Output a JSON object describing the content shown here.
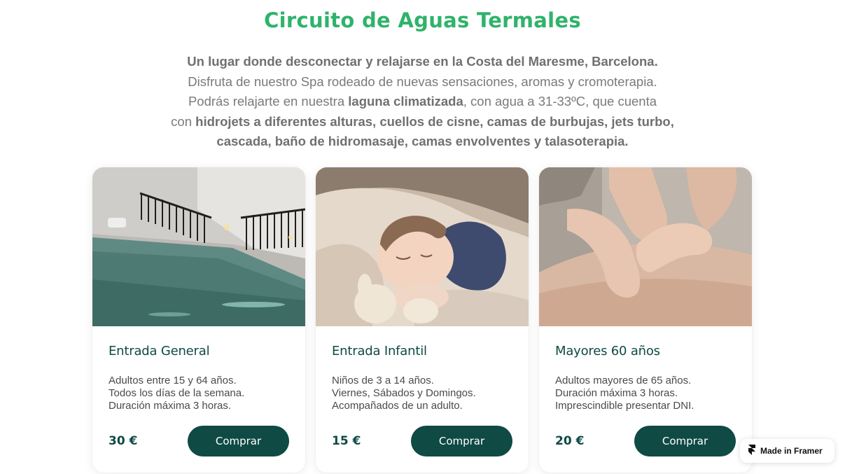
{
  "page": {
    "title": "Circuito de Aguas Termales",
    "intro": {
      "line1": "Un lugar donde desconectar y relajarse en la Costa del Maresme, Barcelona.",
      "line2": "Disfruta de nuestro Spa rodeado de nuevas sensaciones, aromas y cromoterapia.",
      "line3_a": "Podrás relajarte en nuestra ",
      "line3_b": "laguna climatizada",
      "line3_c": ", con agua a 31-33ºC, que cuenta",
      "line4_a": "con ",
      "line4_b": "hidrojets a diferentes alturas, cuellos de cisne, camas de burbujas, jets turbo,",
      "line5": "cascada, baño de hidromasaje, camas envolventes y talasoterapia."
    }
  },
  "cards": [
    {
      "title": "Entrada General",
      "desc": [
        "Adultos entre 15 y 64 años.",
        "Todos los días de la semana.",
        "Duración máxima 3 horas."
      ],
      "price": "30 €",
      "button": "Comprar"
    },
    {
      "title": "Entrada Infantil",
      "desc": [
        "Niños de 3 a 14 años.",
        "Viernes, Sábados y Domingos.",
        "Acompañados de un adulto."
      ],
      "price": "15 €",
      "button": "Comprar"
    },
    {
      "title": "Mayores 60 años",
      "desc": [
        "Adultos mayores de 65 años.",
        "Duración máxima 3 horas.",
        "Imprescindible presentar DNI."
      ],
      "price": "20 €",
      "button": "Comprar"
    }
  ],
  "badge": {
    "label": "Made in Framer",
    "icon": "framer-logo-icon"
  },
  "colors": {
    "title": "#2fb36b",
    "brand_dark": "#0f4a44",
    "text_gray": "#7a7a7a"
  }
}
